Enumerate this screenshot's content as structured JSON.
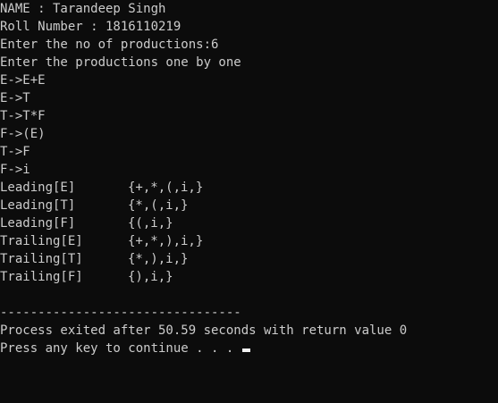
{
  "console": {
    "header": [
      "NAME : Tarandeep Singh",
      "Roll Number : 1816110219",
      "Enter the no of productions:6",
      "Enter the productions one by one"
    ],
    "productions": [
      "E->E+E",
      "E->T",
      "T->T*F",
      "F->(E)",
      "T->F",
      "F->i"
    ],
    "results": [
      {
        "label": "Leading[E]",
        "set": "{+,*,(,i,}"
      },
      {
        "label": "Leading[T]",
        "set": "{*,(,i,}"
      },
      {
        "label": "Leading[F]",
        "set": "{(,i,}"
      },
      {
        "label": "Trailing[E]",
        "set": "{+,*,),i,}"
      },
      {
        "label": "Trailing[T]",
        "set": "{*,),i,}"
      },
      {
        "label": "Trailing[F]",
        "set": "{),i,}"
      }
    ],
    "separator": "--------------------------------",
    "exit_message": "Process exited after 50.59 seconds with return value 0",
    "continue_prompt": "Press any key to continue . . . "
  },
  "colors": {
    "background": "#0c0c0c",
    "text": "#cccccc",
    "cursor": "#f2f2f2"
  }
}
